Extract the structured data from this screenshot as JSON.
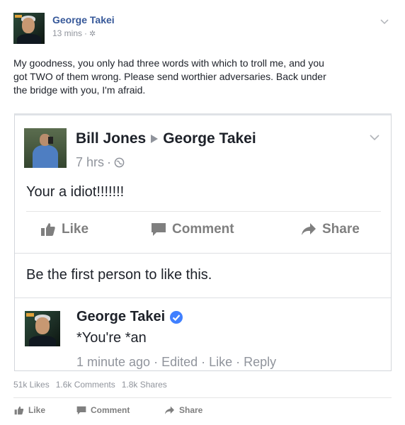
{
  "post": {
    "author": "George Takei",
    "time": "13 mins",
    "separator": "·",
    "privacy_icon": "gear-icon",
    "text_lines": [
      "My goodness, you only had three words with which to troll me, and you",
      "got TWO of them wrong. Please send worthier adversaries. Back under",
      "the bridge with you, I'm afraid."
    ],
    "stats": {
      "likes": "51k Likes",
      "comments": "1.6k Comments",
      "shares": "1.8k Shares"
    },
    "actions": {
      "like": "Like",
      "comment": "Comment",
      "share": "Share"
    }
  },
  "embedded": {
    "author": "Bill Jones",
    "target": "George Takei",
    "time": "7 hrs",
    "separator": "·",
    "privacy_icon": "globe-icon",
    "text": "Your a idiot!!!!!!!",
    "actions": {
      "like": "Like",
      "comment": "Comment",
      "share": "Share"
    },
    "like_prompt": "Be the first person to like this.",
    "reply": {
      "author": "George Takei",
      "text": "*You're *an",
      "meta": "1 minute ago · Edited · Like · Reply"
    }
  },
  "colors": {
    "link_blue": "#365899",
    "muted": "#90949c",
    "verified": "#4080ff"
  }
}
